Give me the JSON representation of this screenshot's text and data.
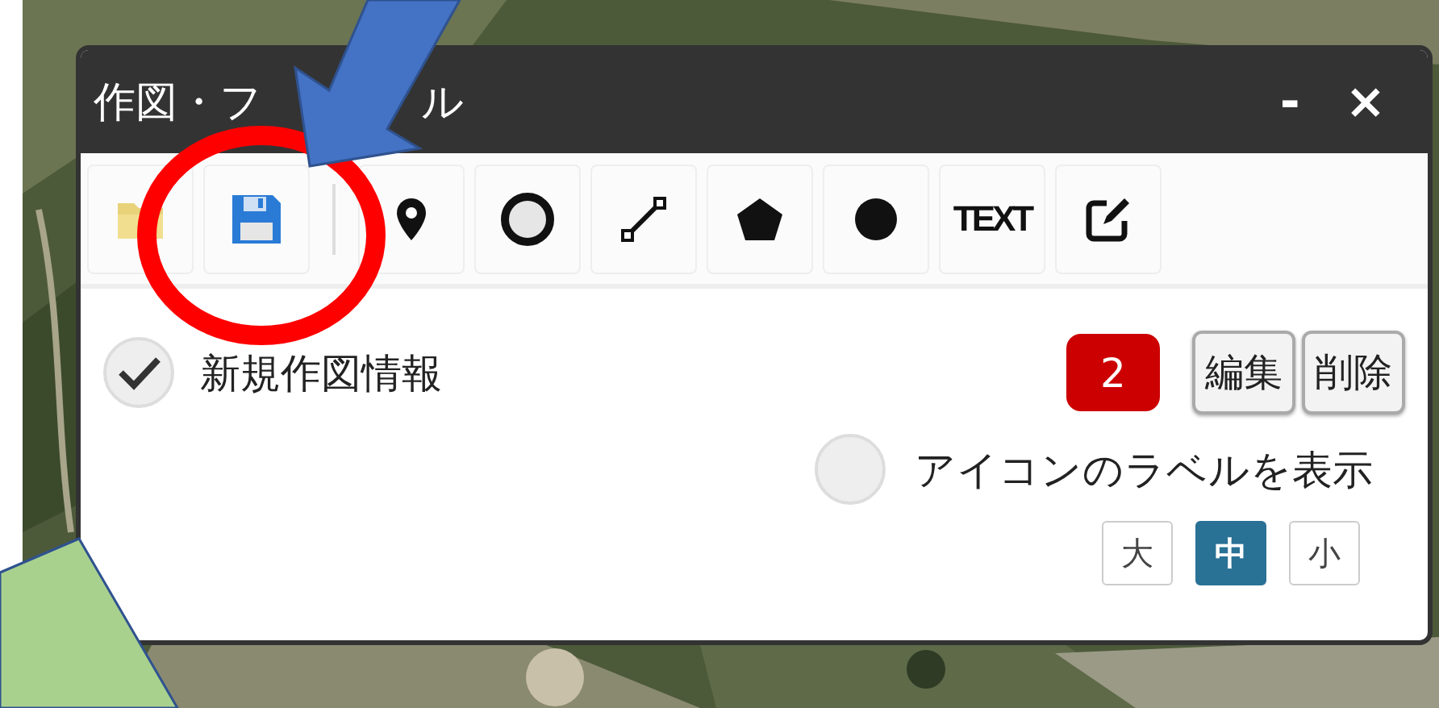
{
  "panel": {
    "title_parts": [
      "作図・フ",
      "ル"
    ],
    "minimize": "-",
    "close": "×"
  },
  "toolbar": {
    "text_button": "TEXT"
  },
  "drawings": [
    {
      "label": "新規作図情報",
      "checked": true,
      "count": "2",
      "actions": [
        "編集",
        "削除"
      ]
    }
  ],
  "label_toggle": {
    "label": "アイコンのラベルを表示",
    "checked": false
  },
  "sizes": [
    {
      "label": "大",
      "selected": false
    },
    {
      "label": "中",
      "selected": true
    },
    {
      "label": "小",
      "selected": false
    }
  ]
}
